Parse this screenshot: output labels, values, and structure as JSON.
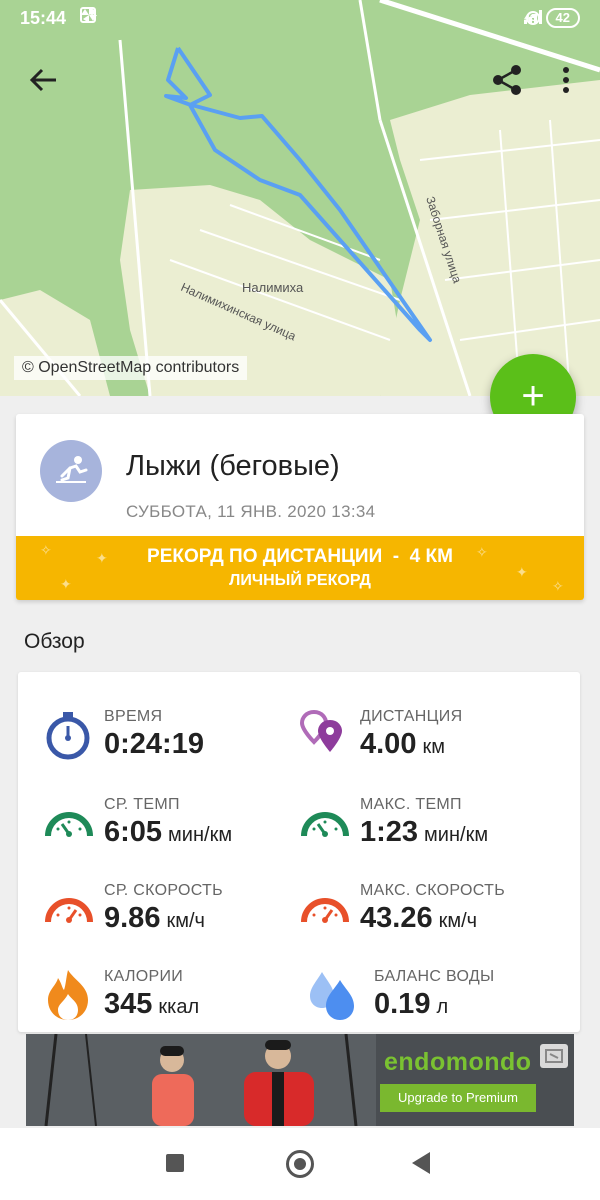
{
  "status": {
    "time": "15:44",
    "battery": "42",
    "network": "4G"
  },
  "map": {
    "credit": "© OpenStreetMap contributors",
    "labels": {
      "village": "Налимиха",
      "street1": "Налимихинская улица",
      "street2": "Заборная улица"
    },
    "route_color": "#5aa0f2"
  },
  "activity": {
    "title": "Лыжи (беговые)",
    "date": "СУББОТА, 11 ЯНВ. 2020 13:34",
    "record_line1": "РЕКОРД ПО ДИСТАНЦИИ  -  4 КМ",
    "record_line2": "ЛИЧНЫЙ РЕКОРД"
  },
  "overview": {
    "title": "Обзор",
    "stats": [
      {
        "label": "ВРЕМЯ",
        "value": "0:24:19",
        "unit": "",
        "icon": "stopwatch-icon",
        "color": "#3a58a8"
      },
      {
        "label": "ДИСТАНЦИЯ",
        "value": "4.00",
        "unit": "км",
        "icon": "location-pins-icon",
        "color": "#8e3c9c"
      },
      {
        "label": "СР. ТЕМП",
        "value": "6:05",
        "unit": "мин/км",
        "icon": "pace-gauge-icon",
        "color": "#1e8a58"
      },
      {
        "label": "МАКС. ТЕМП",
        "value": "1:23",
        "unit": "мин/км",
        "icon": "pace-gauge-icon",
        "color": "#1e8a58"
      },
      {
        "label": "СР. СКОРОСТЬ",
        "value": "9.86",
        "unit": "км/ч",
        "icon": "speed-gauge-icon",
        "color": "#e8502a"
      },
      {
        "label": "МАКС. СКОРОСТЬ",
        "value": "43.26",
        "unit": "км/ч",
        "icon": "speed-gauge-icon",
        "color": "#e8502a"
      },
      {
        "label": "КАЛОРИИ",
        "value": "345",
        "unit": "ккал",
        "icon": "flame-icon",
        "color": "#f08a1c"
      },
      {
        "label": "БАЛАНС ВОДЫ",
        "value": "0.19",
        "unit": "л",
        "icon": "water-drops-icon",
        "color": "#4d8ef0"
      }
    ]
  },
  "ad": {
    "logo": "endomondo",
    "button": "Upgrade to Premium"
  },
  "colors": {
    "accent_green": "#5bbf19",
    "record_yellow": "#f6b600",
    "sport_avatar": "#a7b4dc"
  }
}
